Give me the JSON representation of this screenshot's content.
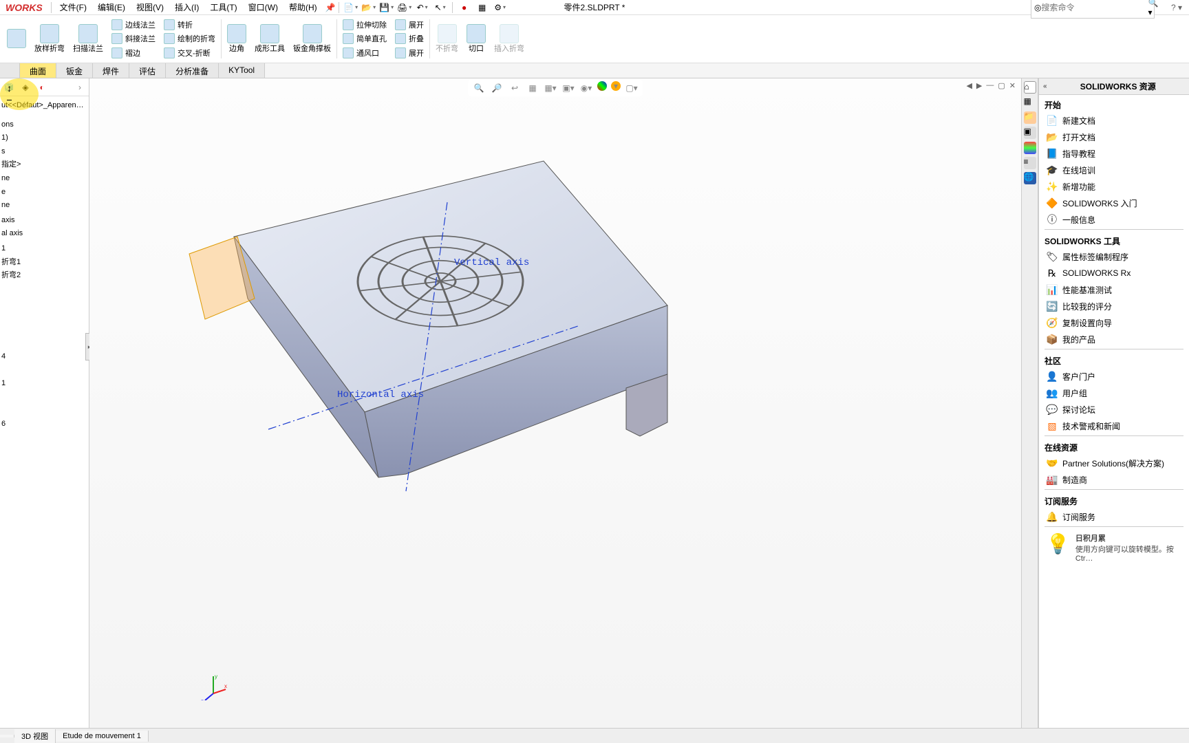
{
  "app": {
    "logo": "WORKS",
    "doc_title": "零件2.SLDPRT *",
    "search_placeholder": "搜索命令",
    "help": "?"
  },
  "menu": {
    "file": "文件(F)",
    "edit": "编辑(E)",
    "view": "视图(V)",
    "insert": "插入(I)",
    "tools": "工具(T)",
    "window": "窗口(W)",
    "help": "帮助(H)"
  },
  "ribbon_big": {
    "b1": "",
    "b2": "放样折弯",
    "b3": "扫描法兰",
    "b4": "边角",
    "b5": "成形工具",
    "b6": "钣金角撑板",
    "b7_label": "不折弯",
    "b8": "切口",
    "b9_label": "插入折弯"
  },
  "ribbon_rows": {
    "r1": "边线法兰",
    "r2": "转折",
    "r3": "斜接法兰",
    "r4": "绘制的折弯",
    "r5": "褶边",
    "r6": "交叉-折断",
    "r7": "拉伸切除",
    "r8": "展开",
    "r9": "简单直孔",
    "r10": "折叠",
    "r11": "通风口",
    "r12": "展开"
  },
  "ribbon_tabs": {
    "t1": "",
    "t2": "曲面",
    "t3": "钣金",
    "t4": "焊件",
    "t5": "评估",
    "t6": "分析准备",
    "t7": "KYTool"
  },
  "tree": {
    "config": "ut<<Défaut>_Apparence Et…",
    "nodes": [
      "ons",
      "1)",
      "s",
      "指定>",
      "ne",
      "e",
      "ne",
      "",
      "axis",
      "al axis",
      "",
      "1",
      "折弯1",
      "折弯2",
      "",
      "",
      "",
      "",
      "",
      "4",
      "",
      "1",
      "",
      "",
      "6"
    ]
  },
  "viewport": {
    "vaxis": "Vertical axis",
    "haxis": "Horizontal axis"
  },
  "taskpane": {
    "title": "SOLIDWORKS 资源",
    "start": "开始",
    "start_items": {
      "i1": "新建文档",
      "i2": "打开文档",
      "i3": "指导教程",
      "i4": "在线培训",
      "i5": "新增功能",
      "i6": "SOLIDWORKS 入门",
      "i7": "一般信息"
    },
    "tools": "SOLIDWORKS 工具",
    "tools_items": {
      "i1": "属性标签编制程序",
      "i2": "SOLIDWORKS Rx",
      "i3": "性能基准测试",
      "i4": "比较我的评分",
      "i5": "复制设置向导",
      "i6": "我的产品"
    },
    "community": "社区",
    "community_items": {
      "i1": "客户门户",
      "i2": "用户组",
      "i3": "探讨论坛",
      "i4": "技术警戒和新闻"
    },
    "online": "在线资源",
    "online_items": {
      "i1": "Partner Solutions(解决方案)",
      "i2": "制造商"
    },
    "subscribe": "订阅服务",
    "subscribe_items": {
      "i1": "订阅服务"
    },
    "tip_title": "日积月累",
    "tip_body": "使用方向键可以旋转模型。按 Ctr…"
  },
  "bottom": {
    "t1": "",
    "t2": "3D 视图",
    "t3": "Etude de mouvement 1"
  }
}
